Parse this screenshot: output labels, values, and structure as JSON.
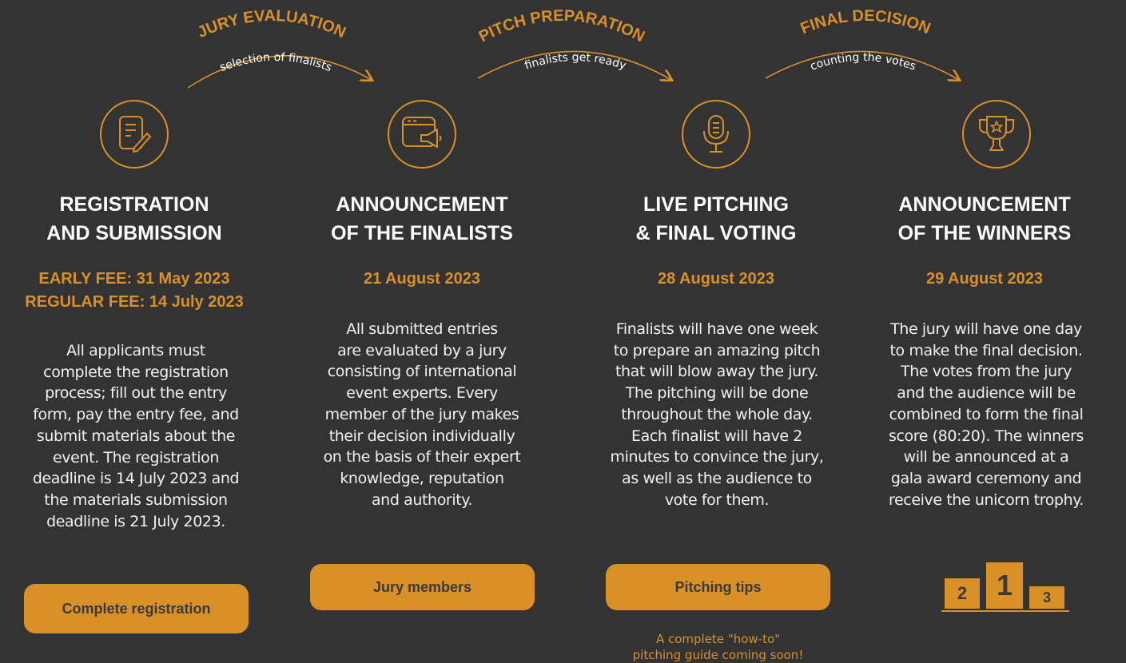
{
  "colors": {
    "background": "#333333",
    "accent": "#d99027",
    "title": "#ffffff",
    "body": "#f0f0f0"
  },
  "phases": [
    {
      "label": "JURY EVALUATION",
      "sub": "selection of finalists"
    },
    {
      "label": "PITCH PREPARATION",
      "sub": "finalists get ready"
    },
    {
      "label": "FINAL DECISION",
      "sub": "counting the votes"
    }
  ],
  "steps": [
    {
      "icon": "document-edit-icon",
      "title": "REGISTRATION\nAND SUBMISSION",
      "date": "EARLY FEE: 31 May 2023\nREGULAR FEE: 14 July 2023",
      "body": "All applicants must\ncomplete the registration\nprocess; fill out the entry\nform, pay the entry fee, and\nsubmit materials about the\nevent. The registration\ndeadline is 14 July 2023 and\nthe materials submission\ndeadline is 21 July 2023.",
      "button": "Complete registration"
    },
    {
      "icon": "browser-megaphone-icon",
      "title": "ANNOUNCEMENT\nOF THE FINALISTS",
      "date": "21 August 2023",
      "body": "All submitted entries\nare evaluated by a jury\nconsisting of international\nevent experts. Every\nmember of the jury makes\ntheir decision individually\non the basis of their expert\nknowledge, reputation\nand authority.",
      "button": "Jury members"
    },
    {
      "icon": "microphone-icon",
      "title": "LIVE PITCHING\n& FINAL VOTING",
      "date": "28 August 2023",
      "body": "Finalists will have one week\nto prepare an amazing pitch\nthat will blow away the jury.\nThe pitching will be done\nthroughout the whole day.\nEach finalist will have 2\nminutes to convince the jury,\nas well as the audience to\nvote for them.",
      "button": "Pitching tips",
      "note": "A complete \"how-to\"\npitching guide coming soon!"
    },
    {
      "icon": "trophy-icon",
      "title": "ANNOUNCEMENT\nOF THE WINNERS",
      "date": "29 August 2023",
      "body": "The jury will have one day\nto make the final decision.\nThe votes from the jury\nand the audience will be\ncombined to form the final\nscore (80:20). The winners\nwill be announced at a\ngala award ceremony and\nreceive the unicorn trophy."
    }
  ],
  "podium": {
    "first": "1",
    "second": "2",
    "third": "3"
  }
}
